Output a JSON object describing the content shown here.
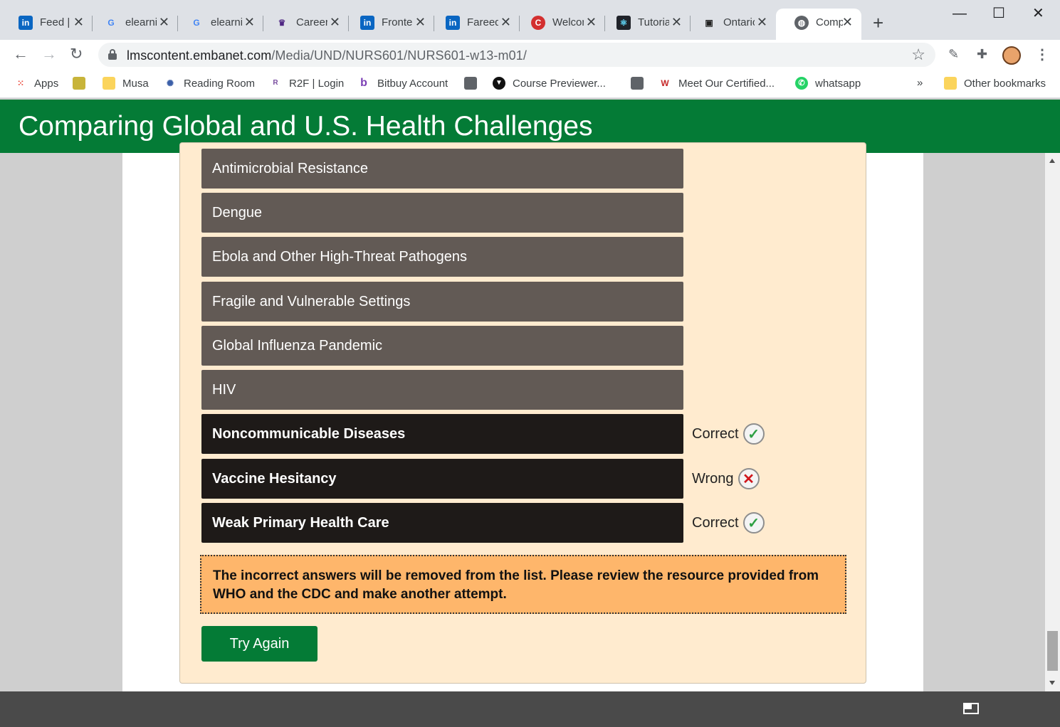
{
  "browser": {
    "tabs": [
      {
        "label": "Feed | LinkedIn",
        "icon": "linkedin-icon",
        "glyph": "in",
        "color": "#0a66c2"
      },
      {
        "label": "elearning",
        "icon": "google-icon",
        "glyph": "G",
        "color": "#4285f4"
      },
      {
        "label": "elearning",
        "icon": "google-icon",
        "glyph": "G",
        "color": "#4285f4"
      },
      {
        "label": "Careers",
        "icon": "university-crest-icon",
        "glyph": "♛",
        "color": "#4f2683"
      },
      {
        "label": "Frontend",
        "icon": "linkedin-icon",
        "glyph": "in",
        "color": "#0a66c2"
      },
      {
        "label": "Fareed",
        "icon": "linkedin-icon",
        "glyph": "in",
        "color": "#0a66c2"
      },
      {
        "label": "Welcome",
        "icon": "red-c-icon",
        "glyph": "C",
        "color": "#d32f2f"
      },
      {
        "label": "Tutorial",
        "icon": "react-icon",
        "glyph": "⚛",
        "color": "#1b6b8f"
      },
      {
        "label": "Ontario",
        "icon": "dms-icon",
        "glyph": "▣",
        "color": "#222222"
      },
      {
        "label": "Comparing",
        "icon": "globe-icon",
        "glyph": "◍",
        "color": "#5f6368"
      }
    ],
    "url_host": "lmscontent.embanet.com",
    "url_path": "/Media/UND/NURS601/NURS601-w13-m01/",
    "bookmarks": {
      "apps": "Apps",
      "musa": "Musa",
      "reading_room": "Reading Room",
      "r2f": "R2F | Login",
      "bitbuy": "Bitbuy Account",
      "course_previewer": "Course Previewer...",
      "meet_certified": "Meet Our Certified...",
      "whatsapp": "whatsapp",
      "overflow": "»",
      "other": "Other bookmarks"
    }
  },
  "page": {
    "title": "Comparing Global and U.S. Health Challenges",
    "items": [
      {
        "label": "Antimicrobial Resistance"
      },
      {
        "label": "Dengue"
      },
      {
        "label": "Ebola and Other High-Threat Pathogens"
      },
      {
        "label": "Fragile and Vulnerable Settings"
      },
      {
        "label": "Global Influenza Pandemic"
      },
      {
        "label": "HIV"
      },
      {
        "label": "Noncommunicable Diseases",
        "result": "Correct"
      },
      {
        "label": "Vaccine Hesitancy",
        "result": "Wrong"
      },
      {
        "label": "Weak Primary Health Care",
        "result": "Correct"
      }
    ],
    "message": "The incorrect answers will be removed from the list. Please review the resource provided from WHO and the CDC and make another attempt.",
    "try_again": "Try Again"
  }
}
